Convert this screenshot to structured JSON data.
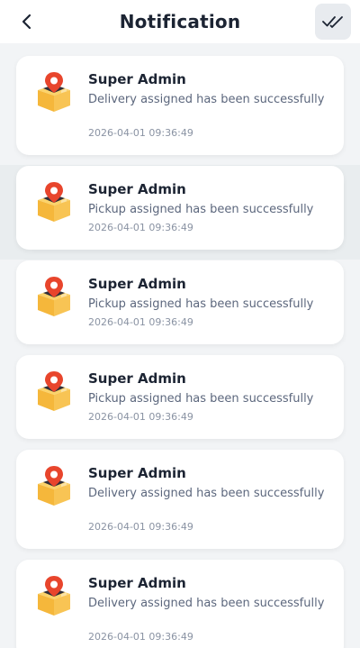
{
  "header": {
    "title": "Notification",
    "back_icon": "chevron-left-icon",
    "mark_read_icon": "double-check-icon"
  },
  "notifications": [
    {
      "sender": "Super Admin",
      "message": "Delivery assigned has been successfully",
      "time": "2026-04-01 09:36:49",
      "icon": "package-location-icon",
      "highlighted": false
    },
    {
      "sender": "Super Admin",
      "message": "Pickup assigned has been successfully",
      "time": "2026-04-01 09:36:49",
      "icon": "package-location-icon",
      "highlighted": true
    },
    {
      "sender": "Super Admin",
      "message": "Pickup assigned has been successfully",
      "time": "2026-04-01 09:36:49",
      "icon": "package-location-icon",
      "highlighted": false
    },
    {
      "sender": "Super Admin",
      "message": "Pickup assigned has been successfully",
      "time": "2026-04-01 09:36:49",
      "icon": "package-location-icon",
      "highlighted": false
    },
    {
      "sender": "Super Admin",
      "message": "Delivery assigned has been successfully",
      "time": "2026-04-01 09:36:49",
      "icon": "package-location-icon",
      "highlighted": false
    },
    {
      "sender": "Super Admin",
      "message": "Delivery assigned has been successfully",
      "time": "2026-04-01 09:36:49",
      "icon": "package-location-icon",
      "highlighted": false
    }
  ],
  "colors": {
    "background": "#f2f4f6",
    "card": "#ffffff",
    "highlight": "#e9edef",
    "pin": "#e8452c",
    "box": "#f5b73b"
  }
}
